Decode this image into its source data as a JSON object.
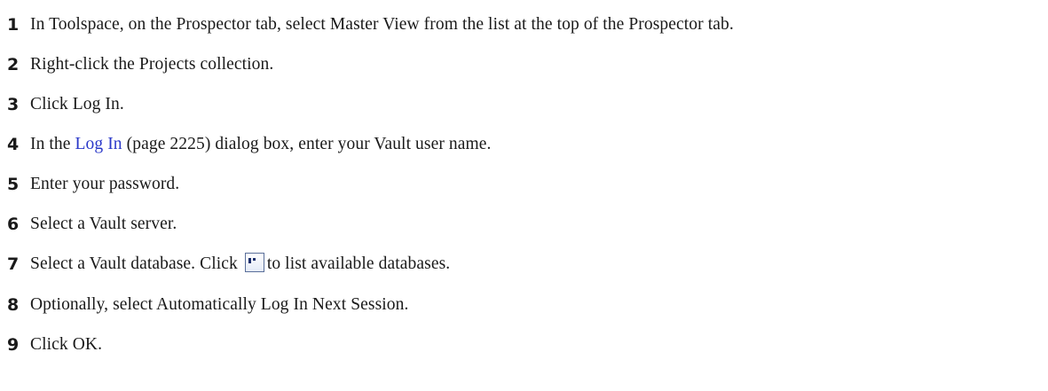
{
  "steps": [
    {
      "number": "1",
      "text": "In Toolspace, on the Prospector tab, select Master View from the list at the top of the Prospector tab."
    },
    {
      "number": "2",
      "text": "Right-click the Projects collection."
    },
    {
      "number": "3",
      "text": "Click Log In."
    },
    {
      "number": "4",
      "before": "In the ",
      "link": "Log In",
      "after": " (page 2225) dialog box, enter your Vault user name."
    },
    {
      "number": "5",
      "text": "Enter your password."
    },
    {
      "number": "6",
      "text": "Select a Vault server."
    },
    {
      "number": "7",
      "before": "Select a Vault database. Click ",
      "after": "to list available databases.",
      "icon": "browse-ellipsis-icon"
    },
    {
      "number": "8",
      "text": "Optionally, select Automatically Log In Next Session."
    },
    {
      "number": "9",
      "text": "Click OK."
    }
  ],
  "colors": {
    "text": "#1a1a1a",
    "link": "#2a38c9"
  }
}
